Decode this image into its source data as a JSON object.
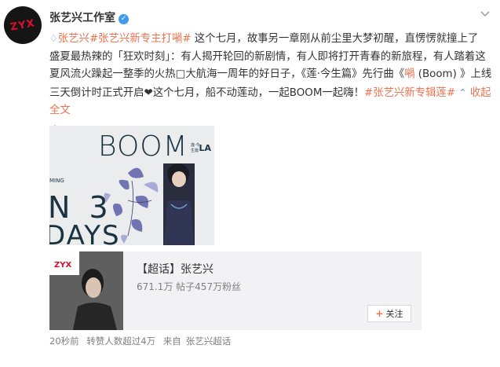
{
  "header": {
    "username": "张艺兴工作室",
    "verified_glyph": "✓"
  },
  "post": {
    "line1_hashtag1": "张艺兴",
    "line1_hashtag2": "张艺兴新专主打𡁜",
    "line1_rest": "这个七月，故事另一章刚从前尘里大梦初醒，直愣愣就撞上了",
    "line2": "盛夏最热辣的「狂欢时刻」：有人揭开轮回的新剧情，有人即将打开青春的新旅程，有人踏着这",
    "line3_pre": "夏风流火躁起一整季的火热□大航海一周年的好日子，《莲·今生篇》先行曲《",
    "line3_link": "𡁜",
    "line3_post": " (Boom) 》上线",
    "line4_pre": "三天倒计时正式开启❤这个七月，船不动莲动，一起BOOM一起嗨！",
    "line4_hashtag": "#张艺兴新专辑莲#",
    "line4_collapse": "收起全文",
    "collapse_icon": "chevron-up-icon"
  },
  "media": {
    "title": "BOOM",
    "corner": "LA",
    "coming": "MING",
    "countdown_line1": "N 3",
    "countdown_line2": "DAYS",
    "small_text": "莲·今生篇"
  },
  "topic": {
    "title": "【超话】张艺兴",
    "stats": "671.1万  帖子457万粉丝",
    "follow_plus": "+",
    "follow_label": "关注"
  },
  "meta": {
    "time": "20秒前",
    "reposts": "转赞人数超过4万",
    "source_prefix": "来自",
    "source": "张艺兴超话"
  },
  "colors": {
    "accent": "#eb7350",
    "text": "#333333",
    "muted": "#808080",
    "verified": "#3f9cea",
    "brand_red": "#d4112b"
  }
}
